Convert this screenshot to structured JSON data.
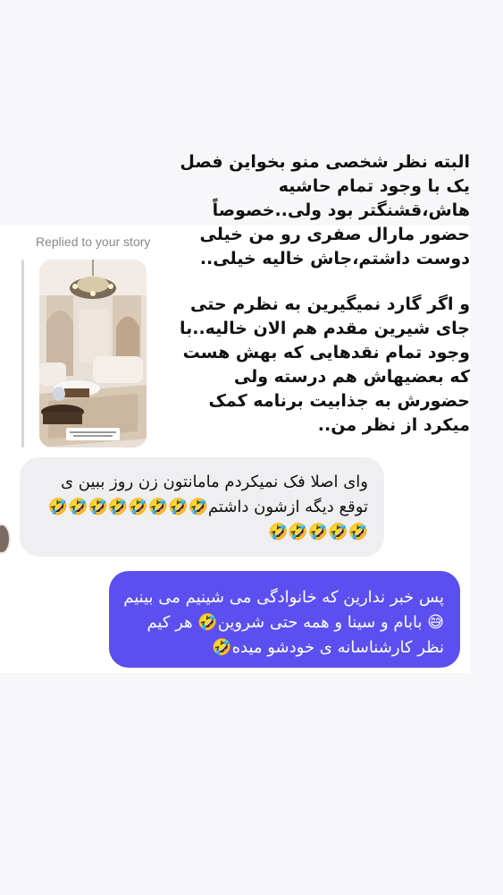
{
  "story_caption": {
    "paragraph1": "البته نظر شخصی منو بخواین فصل یک با وجود تمام حاشیه هاش،قشنگتر بود ولی..خصوصاً حضور مارال صفری رو من خیلی دوست داشتم،جاش خالیه خیلی..",
    "paragraph2": "و اگر گارد نمیگیرین به نظرم حتی جای شیرین مقدم هم الان خالیه..با وجود تمام نقدهایی که بهش هست که بعضیهاش هم درسته ولی حضورش به جذابیت برنامه کمک میکرد از نظر من.."
  },
  "reply": {
    "label": "Replied to your story"
  },
  "incoming_message": {
    "text": "وای اصلا فک نمیکردم مامانتون زن روز ببین ی توقع دیگه ازشون داشتم🤣🤣🤣🤣🤣🤣🤣🤣🤣🤣🤣🤣🤣"
  },
  "outgoing_message": {
    "text": "پس خبر ندارین که خانوادگی می شینیم می بینیم😅 بابام و سینا و همه حتی شروین🤣 هر کیم نظر کارشناسانه ی خودشو میده🤣"
  },
  "colors": {
    "outgoing_bubble": "#5b4ff0",
    "incoming_bubble": "#efeff1",
    "background": "#f7f7f9"
  }
}
